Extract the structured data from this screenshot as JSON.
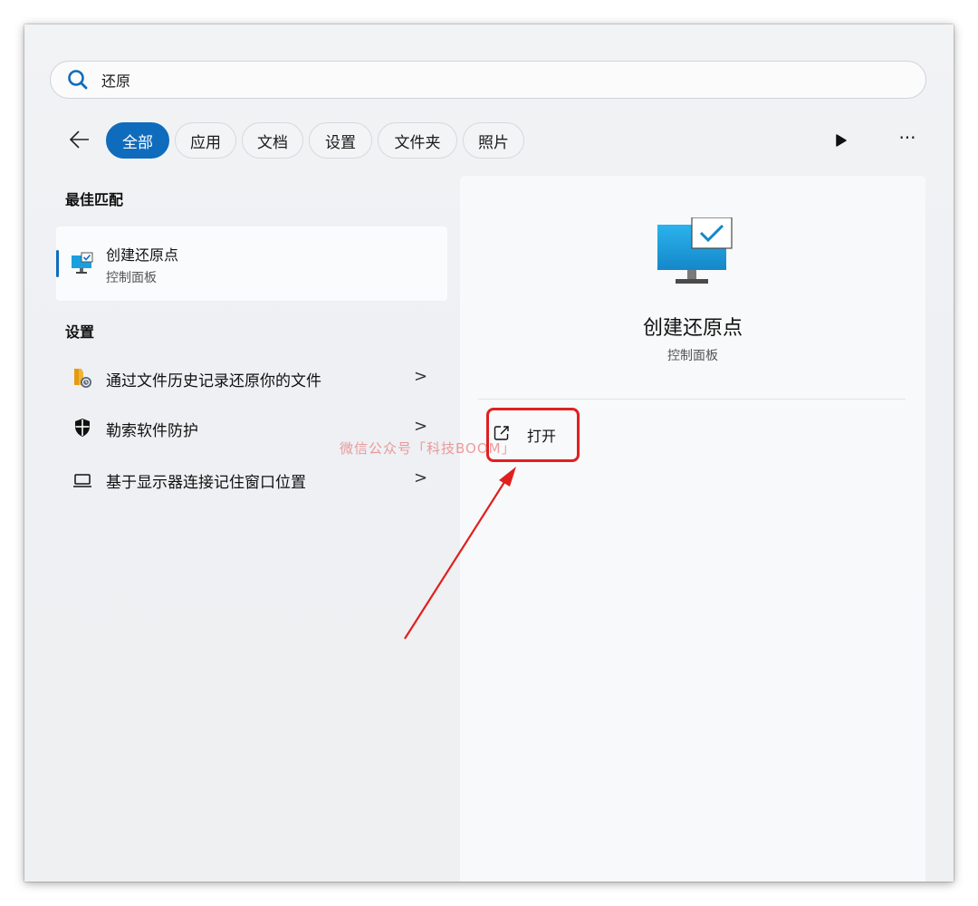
{
  "search": {
    "value": "还原"
  },
  "filters": [
    {
      "label": "全部",
      "active": true
    },
    {
      "label": "应用"
    },
    {
      "label": "文档"
    },
    {
      "label": "设置"
    },
    {
      "label": "文件夹"
    },
    {
      "label": "照片"
    }
  ],
  "icons": {
    "search": "search-icon",
    "back": "back-arrow-icon",
    "play": "play-icon",
    "more": "more-icon",
    "monitor": "monitor-check-icon",
    "folder_history": "file-history-icon",
    "shield": "shield-icon",
    "laptop": "laptop-icon",
    "open": "open-external-icon"
  },
  "more_label": "···",
  "best_match": {
    "title": "最佳匹配",
    "item": {
      "name": "创建还原点",
      "subtitle": "控制面板"
    }
  },
  "settings": {
    "title": "设置",
    "items": [
      {
        "label": "通过文件历史记录还原你的文件",
        "chevron": ">"
      },
      {
        "label": "勒索软件防护",
        "chevron": ">"
      },
      {
        "label": "基于显示器连接记住窗口位置",
        "chevron": ">"
      }
    ]
  },
  "preview": {
    "title": "创建还原点",
    "subtitle": "控制面板",
    "action_label": "打开"
  },
  "watermark": "微信公众号「科技BOOM」",
  "colors": {
    "accent": "#0f6cbd",
    "annotation": "#e02020"
  }
}
